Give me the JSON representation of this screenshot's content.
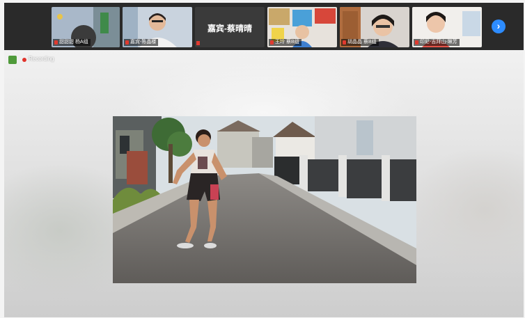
{
  "participants": [
    {
      "name": "甜甜甜 杨A组"
    },
    {
      "name": "嘉宾-陈晶楼"
    },
    {
      "name": "嘉宾-蔡晴晴"
    },
    {
      "name": "王玲 蔡B组"
    },
    {
      "name": "胡晶晶 蔡B组"
    },
    {
      "name": "印尼-吉拜山-琳芳"
    }
  ],
  "next_button": "›",
  "recording": {
    "label": "Recording"
  },
  "colors": {
    "accent": "#2d8cff",
    "recording": "#e0322a",
    "topbar": "#2a2a2a"
  }
}
